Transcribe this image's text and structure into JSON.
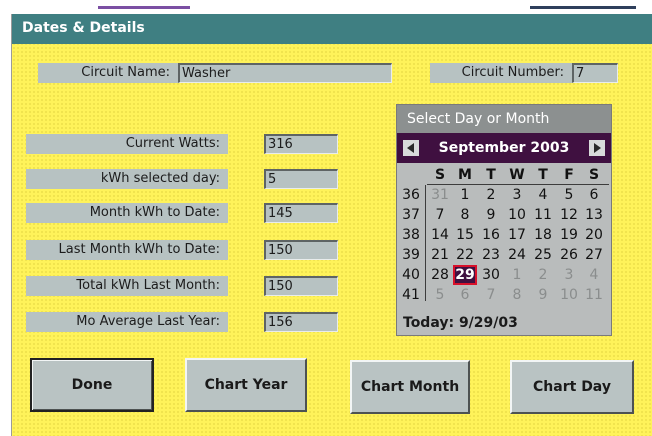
{
  "window": {
    "title": "Dates & Details"
  },
  "circuit": {
    "name_label": "Circuit Name:",
    "name_value": "Washer",
    "number_label": "Circuit Number:",
    "number_value": "7"
  },
  "stats": [
    {
      "label": "Current Watts:",
      "value": "316"
    },
    {
      "label": "kWh selected day:",
      "value": "5"
    },
    {
      "label": "Month kWh to Date:",
      "value": "145"
    },
    {
      "label": "Last Month kWh to Date:",
      "value": "150"
    },
    {
      "label": "Total kWh Last Month:",
      "value": "150"
    },
    {
      "label": "Mo Average Last Year:",
      "value": "156"
    }
  ],
  "calendar": {
    "header": "Select Day or Month",
    "month_title": "September 2003",
    "weekdays": [
      "S",
      "M",
      "T",
      "W",
      "T",
      "F",
      "S"
    ],
    "weeks": [
      {
        "week": "36",
        "days": [
          {
            "d": "31",
            "o": true
          },
          {
            "d": "1"
          },
          {
            "d": "2"
          },
          {
            "d": "3"
          },
          {
            "d": "4"
          },
          {
            "d": "5"
          },
          {
            "d": "6"
          }
        ]
      },
      {
        "week": "37",
        "days": [
          {
            "d": "7"
          },
          {
            "d": "8"
          },
          {
            "d": "9"
          },
          {
            "d": "10"
          },
          {
            "d": "11"
          },
          {
            "d": "12"
          },
          {
            "d": "13"
          }
        ]
      },
      {
        "week": "38",
        "days": [
          {
            "d": "14"
          },
          {
            "d": "15"
          },
          {
            "d": "16"
          },
          {
            "d": "17"
          },
          {
            "d": "18"
          },
          {
            "d": "19"
          },
          {
            "d": "20"
          }
        ]
      },
      {
        "week": "39",
        "days": [
          {
            "d": "21"
          },
          {
            "d": "22"
          },
          {
            "d": "23"
          },
          {
            "d": "24"
          },
          {
            "d": "25"
          },
          {
            "d": "26"
          },
          {
            "d": "27"
          }
        ]
      },
      {
        "week": "40",
        "days": [
          {
            "d": "28"
          },
          {
            "d": "29",
            "s": true
          },
          {
            "d": "30"
          },
          {
            "d": "1",
            "o": true
          },
          {
            "d": "2",
            "o": true
          },
          {
            "d": "3",
            "o": true
          },
          {
            "d": "4",
            "o": true
          }
        ]
      },
      {
        "week": "41",
        "days": [
          {
            "d": "5",
            "o": true
          },
          {
            "d": "6",
            "o": true
          },
          {
            "d": "7",
            "o": true
          },
          {
            "d": "8",
            "o": true
          },
          {
            "d": "9",
            "o": true
          },
          {
            "d": "10",
            "o": true
          },
          {
            "d": "11",
            "o": true
          }
        ]
      }
    ],
    "today_text": "Today: 9/29/03"
  },
  "buttons": {
    "done": "Done",
    "chart_year": "Chart Year",
    "chart_month": "Chart Month",
    "chart_day": "Chart Day"
  },
  "colors": {
    "background": "#fff35a",
    "title_bar": "#3f7f82",
    "calendar_month_bar": "#3f1040",
    "selected_day_outline": "#d8102a"
  }
}
